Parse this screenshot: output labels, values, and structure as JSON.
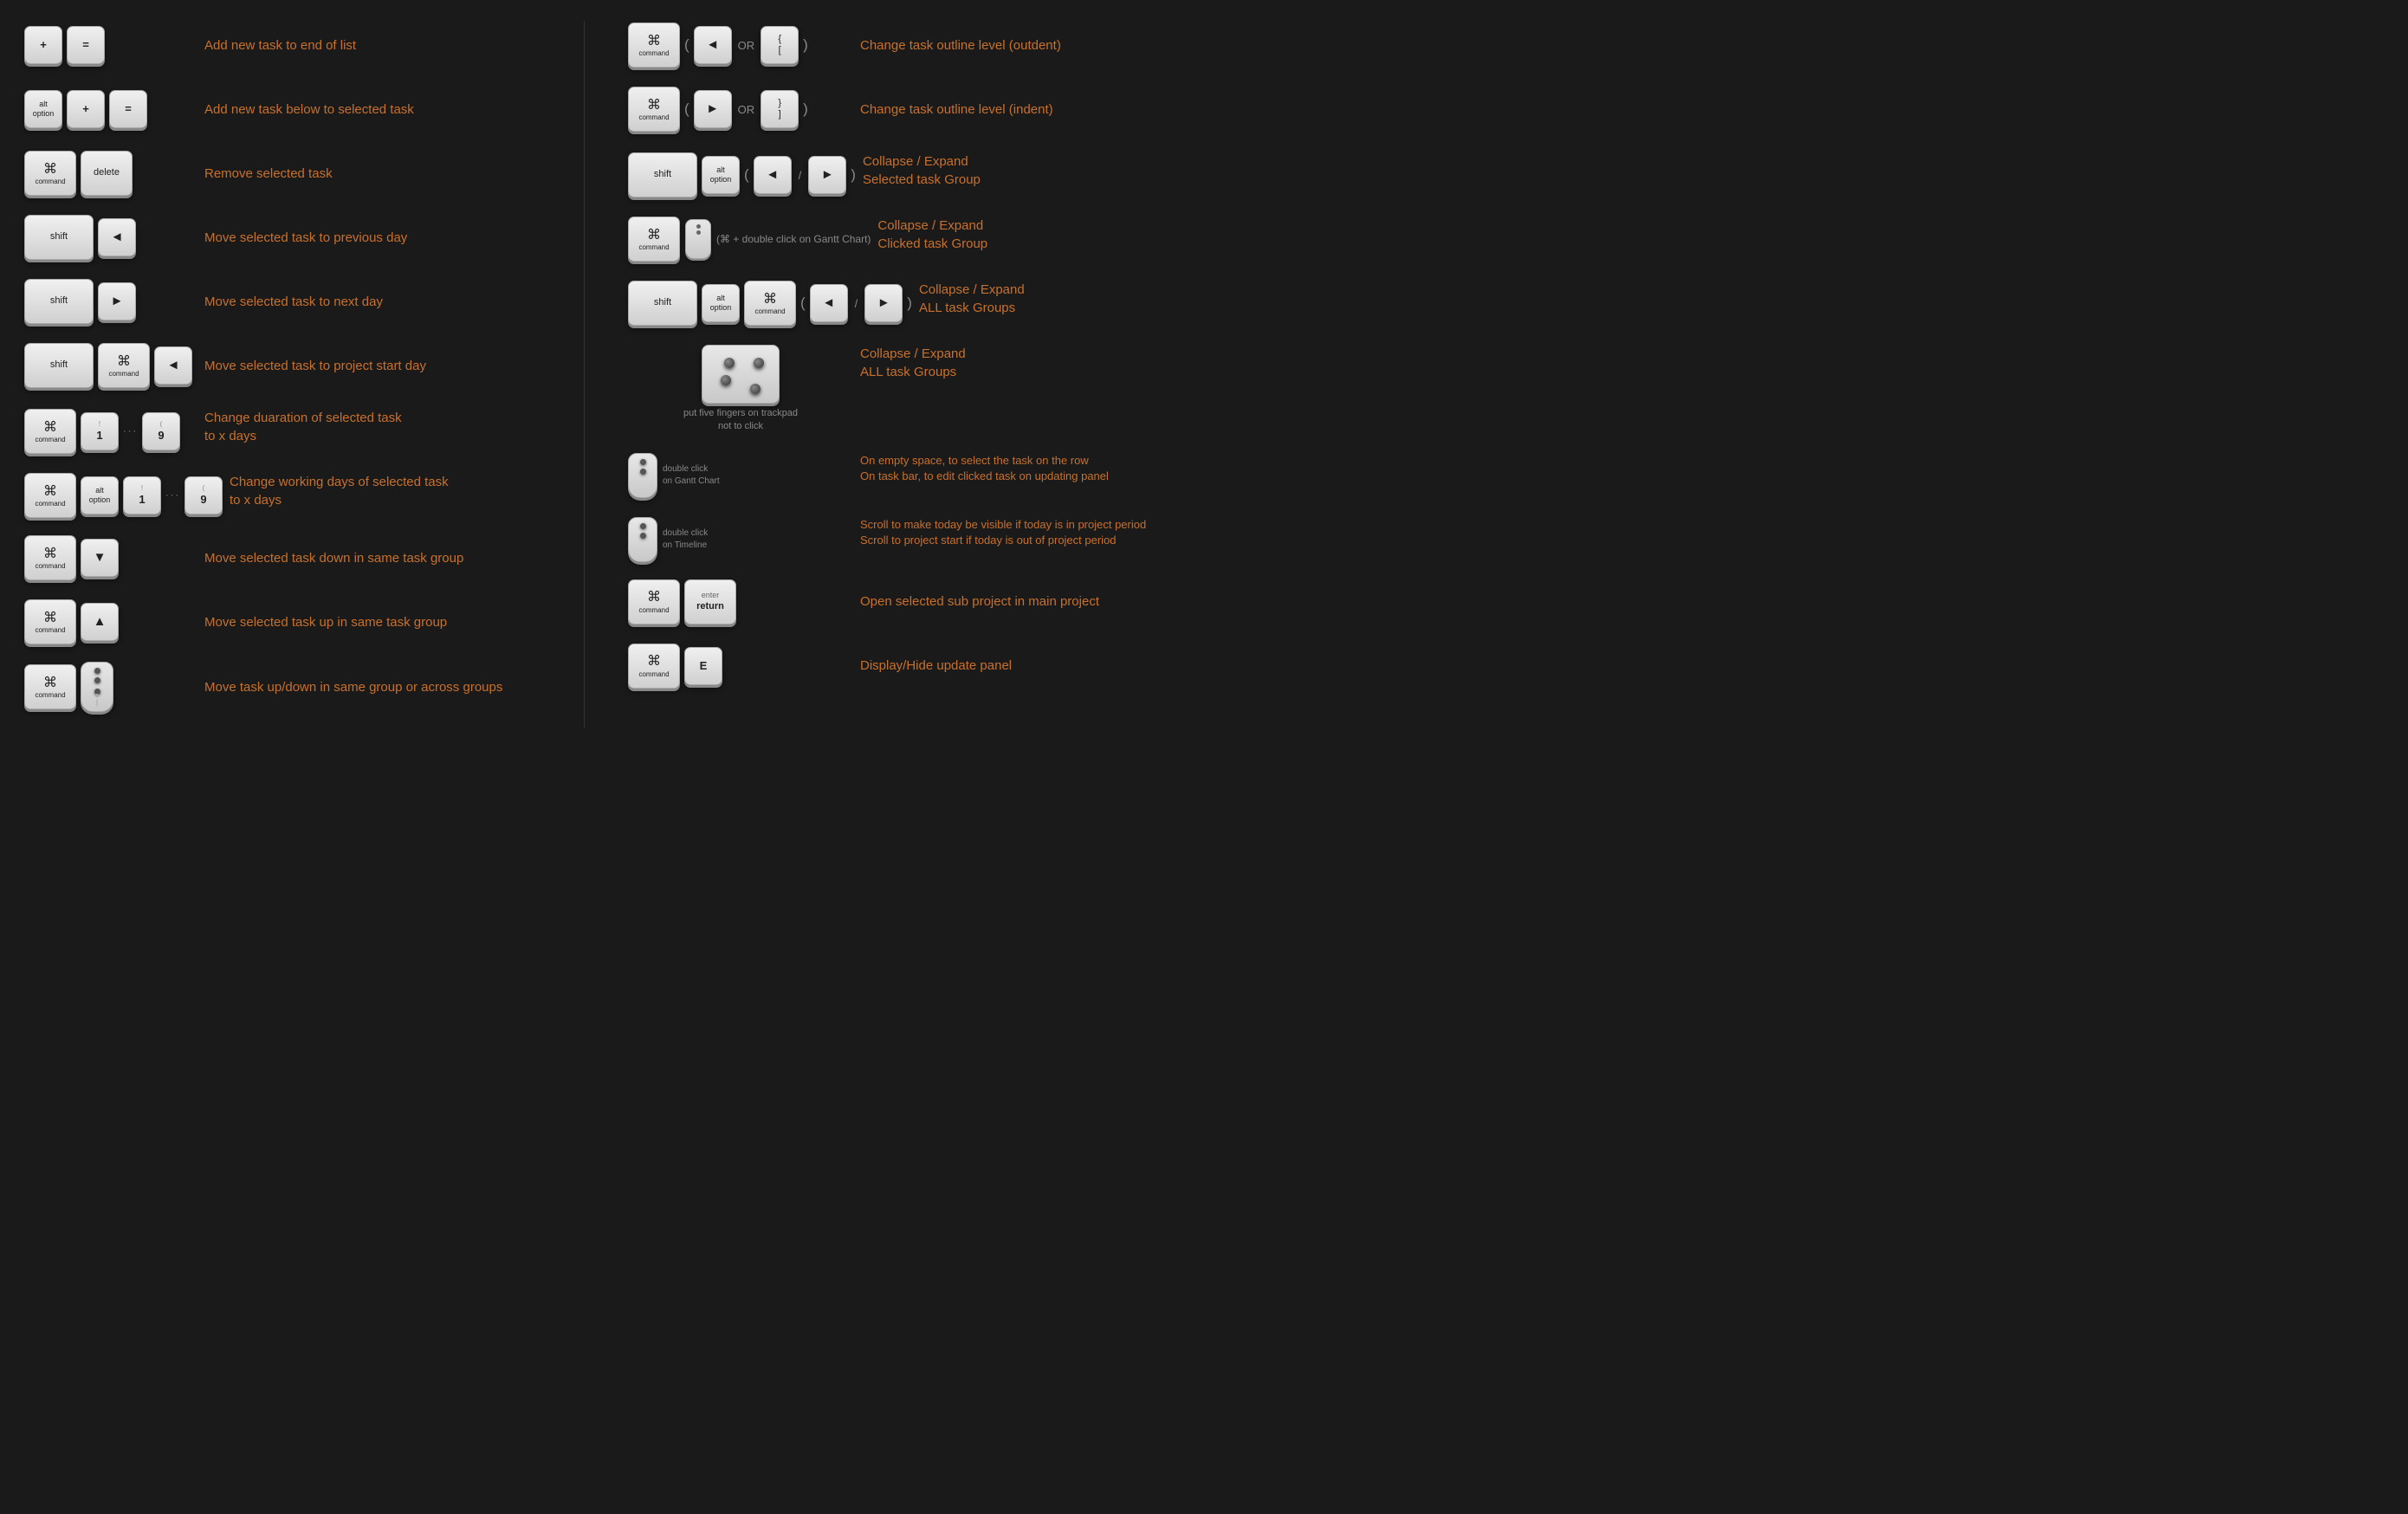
{
  "left": {
    "rows": [
      {
        "id": "add-end",
        "keys": [
          {
            "label": "+",
            "size": "small"
          },
          {
            "label": "=",
            "size": "small"
          }
        ],
        "desc": "Add new task to end of list"
      },
      {
        "id": "add-below",
        "keys": [
          {
            "label": "alt\noption",
            "size": "small"
          },
          {
            "label": "+",
            "size": "small"
          },
          {
            "label": "=",
            "size": "small"
          }
        ],
        "desc": "Add new task below to selected task"
      },
      {
        "id": "remove",
        "keys": [
          {
            "label": "⌘\ncommand",
            "size": "medium",
            "type": "cmd"
          },
          {
            "label": "delete",
            "size": "medium"
          }
        ],
        "desc": "Remove selected task"
      },
      {
        "id": "prev-day",
        "keys": [
          {
            "label": "shift",
            "size": "wide"
          },
          {
            "label": "◄",
            "size": "small"
          }
        ],
        "desc": "Move selected task to previous day"
      },
      {
        "id": "next-day",
        "keys": [
          {
            "label": "shift",
            "size": "wide"
          },
          {
            "label": "►",
            "size": "small"
          }
        ],
        "desc": "Move selected task to next day"
      },
      {
        "id": "start-day",
        "keys": [
          {
            "label": "shift",
            "size": "wide"
          },
          {
            "label": "⌘\ncommand",
            "size": "medium",
            "type": "cmd"
          },
          {
            "label": "◄",
            "size": "small"
          }
        ],
        "desc": "Move selected task to project start day"
      },
      {
        "id": "duration",
        "keys": [
          {
            "label": "⌘\ncommand",
            "size": "medium",
            "type": "cmd"
          },
          {
            "label": "!\n1",
            "size": "small"
          },
          {
            "dots": true
          },
          {
            "label": "(\n9",
            "size": "small"
          }
        ],
        "desc": "Change duaration of selected task\nto x days"
      },
      {
        "id": "working-days",
        "keys": [
          {
            "label": "⌘\ncommand",
            "size": "medium",
            "type": "cmd"
          },
          {
            "label": "alt\noption",
            "size": "small"
          },
          {
            "label": "!\n1",
            "size": "small"
          },
          {
            "dots": true
          },
          {
            "label": "(\n9",
            "size": "small"
          }
        ],
        "desc": "Change working days of selected task\nto x days"
      },
      {
        "id": "move-down",
        "keys": [
          {
            "label": "⌘\ncommand",
            "size": "medium",
            "type": "cmd"
          },
          {
            "label": "▼",
            "size": "small"
          }
        ],
        "desc": "Move selected task down in same task group"
      },
      {
        "id": "move-up",
        "keys": [
          {
            "label": "⌘\ncommand",
            "size": "medium",
            "type": "cmd"
          },
          {
            "label": "▲",
            "size": "small"
          }
        ],
        "desc": "Move selected task up in same task group"
      },
      {
        "id": "move-updown",
        "keys": [
          {
            "label": "⌘\ncommand",
            "size": "medium",
            "type": "cmd"
          },
          {
            "mouse": true
          }
        ],
        "desc": "Move task up/down in same group or across groups"
      }
    ]
  },
  "right": {
    "rows": [
      {
        "id": "outdent",
        "keys": [
          {
            "label": "⌘\ncommand",
            "size": "medium",
            "type": "cmd"
          }
        ],
        "or_keys": [
          {
            "label": "◄",
            "size": "small"
          },
          {
            "label": "OR"
          },
          {
            "label": "{\n[",
            "size": "small"
          }
        ],
        "desc": "Change task outline level (outdent)"
      },
      {
        "id": "indent",
        "keys": [
          {
            "label": "⌘\ncommand",
            "size": "medium",
            "type": "cmd"
          }
        ],
        "or_keys": [
          {
            "label": "►",
            "size": "small"
          },
          {
            "label": "OR"
          },
          {
            "label": "}\n]",
            "size": "small"
          }
        ],
        "desc": "Change task outline level (indent)"
      },
      {
        "id": "collapse-selected",
        "keys": [
          {
            "label": "shift",
            "size": "wide"
          },
          {
            "label": "alt\noption",
            "size": "small"
          }
        ],
        "arrow_keys": [
          {
            "label": "◄"
          },
          {
            "sep": "/"
          },
          {
            "label": "►"
          }
        ],
        "desc": "Collapse / Expand\nSelected task Group"
      },
      {
        "id": "collapse-clicked",
        "keys": [
          {
            "label": "⌘\ncommand",
            "size": "medium",
            "type": "cmd"
          },
          {
            "mouse_small": true
          }
        ],
        "extra_text": "(⌘ + double click on Gantt Chart)",
        "desc": "Collapse / Expand\nClicked task Group"
      },
      {
        "id": "collapse-all",
        "keys": [
          {
            "label": "shift",
            "size": "wide"
          },
          {
            "label": "alt\noption",
            "size": "small"
          },
          {
            "label": "⌘\ncommand",
            "size": "medium",
            "type": "cmd"
          }
        ],
        "arrow_keys": [
          {
            "label": "◄"
          },
          {
            "sep": "/"
          },
          {
            "label": "►"
          }
        ],
        "desc": "Collapse / Expand\nALL task Groups"
      },
      {
        "id": "trackpad-collapse",
        "trackpad": true,
        "trackpad_text": "put five fingers on trackpad\nnot to click",
        "desc": "Collapse / Expand\nALL task Groups"
      },
      {
        "id": "double-click-gantt",
        "mouse_double": true,
        "mouse_label": "double click\non Gantt Chart",
        "desc": "On empty space, to select the task on the row\nOn task bar,  to edit clicked task on updating panel"
      },
      {
        "id": "double-click-timeline",
        "mouse_double2": true,
        "mouse_label": "double click\non Timeline",
        "desc": "Scroll to make today be visible if today is in project period\nScroll to project start if today is out of project period"
      },
      {
        "id": "open-subproject",
        "keys": [
          {
            "label": "⌘\ncommand",
            "size": "medium",
            "type": "cmd"
          },
          {
            "label": "enter\nreturn",
            "size": "medium"
          }
        ],
        "desc": "Open selected sub project in main project"
      },
      {
        "id": "display-panel",
        "keys": [
          {
            "label": "⌘\ncommand",
            "size": "medium",
            "type": "cmd"
          },
          {
            "label": "E",
            "size": "small"
          }
        ],
        "desc": "Display/Hide update panel"
      }
    ]
  }
}
